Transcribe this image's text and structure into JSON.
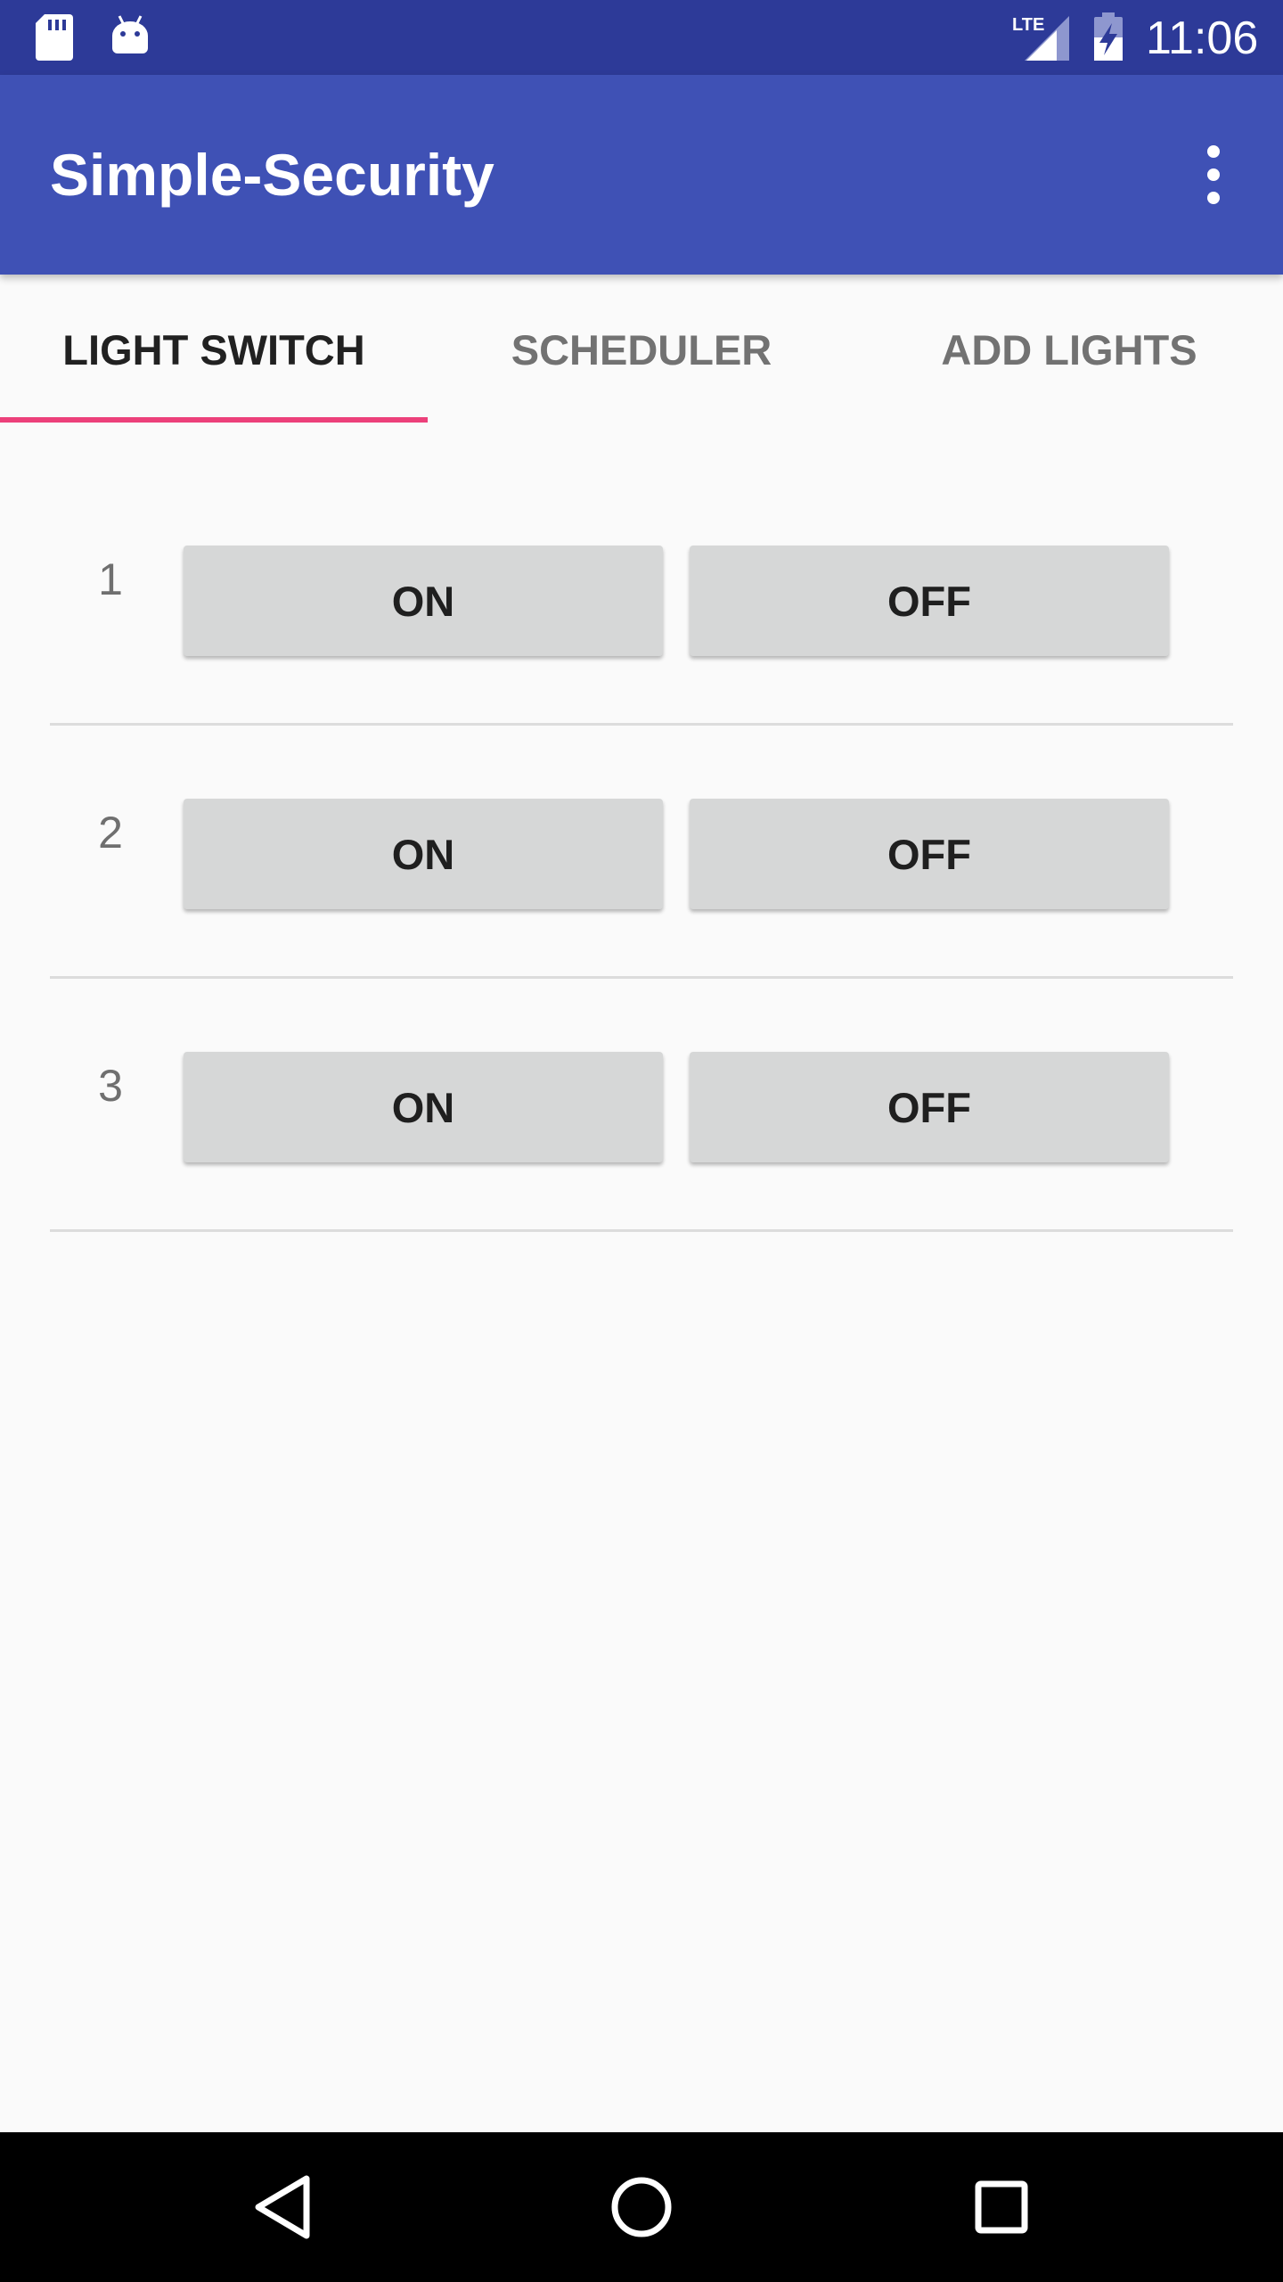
{
  "status_bar": {
    "time": "11:06",
    "network_label": "LTE",
    "icons": [
      "sd-card-icon",
      "android-icon",
      "lte-signal-icon",
      "battery-charging-icon"
    ]
  },
  "app_bar": {
    "title": "Simple-Security",
    "menu_icon": "more-vert-icon"
  },
  "tabs": [
    {
      "label": "LIGHT SWITCH",
      "active": true
    },
    {
      "label": "SCHEDULER",
      "active": false
    },
    {
      "label": "ADD LIGHTS",
      "active": false
    }
  ],
  "lights": [
    {
      "number": "1",
      "on_label": "ON",
      "off_label": "OFF"
    },
    {
      "number": "2",
      "on_label": "ON",
      "off_label": "OFF"
    },
    {
      "number": "3",
      "on_label": "ON",
      "off_label": "OFF"
    }
  ],
  "nav_bar": {
    "icons": [
      "back-icon",
      "home-icon",
      "recents-icon"
    ]
  },
  "colors": {
    "status_bar": "#2d3a98",
    "primary": "#3f51b5",
    "tab_indicator": "#ec407a",
    "button_bg": "#d6d7d7",
    "background": "#fafafa"
  }
}
